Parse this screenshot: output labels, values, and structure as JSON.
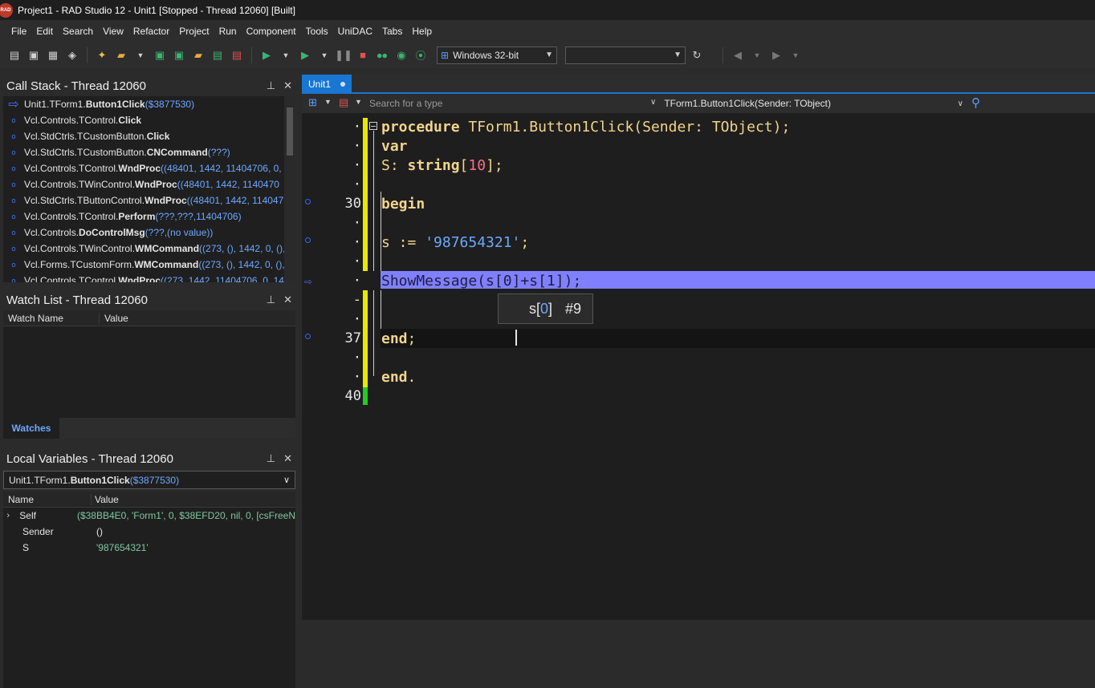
{
  "window": {
    "title": "Project1 - RAD Studio 12 - Unit1 [Stopped - Thread 12060] [Built]",
    "logo_text": "RAD"
  },
  "menu": [
    "File",
    "Edit",
    "Search",
    "View",
    "Refactor",
    "Project",
    "Run",
    "Component",
    "Tools",
    "UniDAC",
    "Tabs",
    "Help"
  ],
  "toolbar": {
    "platform": "Windows 32-bit",
    "config": ""
  },
  "call_stack": {
    "title": "Call Stack - Thread 12060",
    "rows": [
      {
        "pre": "Unit1.TForm1.",
        "bold": "Button1Click",
        "args": "($3877530)"
      },
      {
        "pre": "Vcl.Controls.TControl.",
        "bold": "Click",
        "args": ""
      },
      {
        "pre": "Vcl.StdCtrls.TCustomButton.",
        "bold": "Click",
        "args": ""
      },
      {
        "pre": "Vcl.StdCtrls.TCustomButton.",
        "bold": "CNCommand",
        "args": "(???)"
      },
      {
        "pre": "Vcl.Controls.TControl.",
        "bold": "WndProc",
        "args": "((48401, 1442, 11404706, 0,"
      },
      {
        "pre": "Vcl.Controls.TWinControl.",
        "bold": "WndProc",
        "args": "((48401, 1442, 1140470"
      },
      {
        "pre": "Vcl.StdCtrls.TButtonControl.",
        "bold": "WndProc",
        "args": "((48401, 1442, 114047"
      },
      {
        "pre": "Vcl.Controls.TControl.",
        "bold": "Perform",
        "args": "(???,???,11404706)"
      },
      {
        "pre": "Vcl.Controls.",
        "bold": "DoControlMsg",
        "args": "(???,(no value))"
      },
      {
        "pre": "Vcl.Controls.TWinControl.",
        "bold": "WMCommand",
        "args": "((273, (), 1442, 0, (),"
      },
      {
        "pre": "Vcl.Forms.TCustomForm.",
        "bold": "WMCommand",
        "args": "((273, (), 1442, 0, (),"
      },
      {
        "pre": "Vcl.Controls.TControl.",
        "bold": "WndProc",
        "args": "((273, 1442, 11404706, 0, 14"
      }
    ]
  },
  "watch_list": {
    "title": "Watch List - Thread 12060",
    "col_name": "Watch Name",
    "col_value": "Value",
    "tab": "Watches"
  },
  "locals": {
    "title": "Local Variables - Thread 12060",
    "frame_pre": "Unit1.TForm1.",
    "frame_bold": "Button1Click",
    "frame_args": "($3877530)",
    "col_name": "Name",
    "col_value": "Value",
    "rows": [
      {
        "name": "Self",
        "value": "($38BB4E0, 'Form1', 0, $38EFD20, nil, 0, [csFreeN",
        "expand": "›"
      },
      {
        "name": "Sender",
        "value": "()",
        "expand": ""
      },
      {
        "name": "S",
        "value": "'987654321'",
        "expand": ""
      }
    ]
  },
  "editor": {
    "tab": "Unit1",
    "search_placeholder": "Search for a type",
    "method": "TForm1.Button1Click(Sender: TObject)",
    "line_labels": [
      "·",
      "·",
      "·",
      "·",
      "30",
      "·",
      "·",
      "·",
      "·",
      "-",
      "·",
      "37",
      "·",
      "·",
      "40"
    ],
    "tooltip_expr_pre": "s[",
    "tooltip_expr_idx": "0",
    "tooltip_expr_post": "]",
    "tooltip_value": "#9"
  }
}
